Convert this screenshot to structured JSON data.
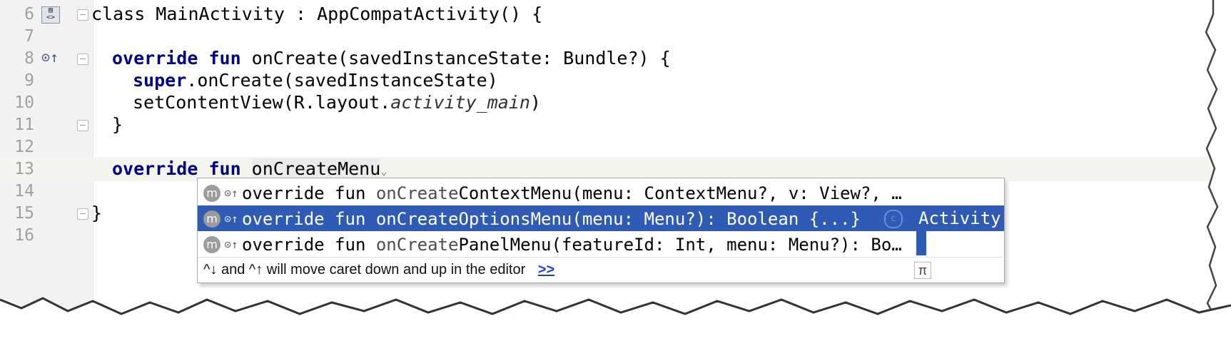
{
  "editor": {
    "lines": [
      {
        "num": "6",
        "code": "class MainActivity : AppCompatActivity() {"
      },
      {
        "num": "7",
        "code": ""
      },
      {
        "num": "8",
        "kw": "override fun ",
        "code": "onCreate(savedInstanceState: Bundle?) {"
      },
      {
        "num": "9",
        "kw": "super",
        "code": ".onCreate(savedInstanceState)"
      },
      {
        "num": "10",
        "code_a": "setContentView(R.layout.",
        "code_it": "activity_main",
        "code_b": ")"
      },
      {
        "num": "11",
        "code": "}"
      },
      {
        "num": "12",
        "code": ""
      },
      {
        "num": "13",
        "kw": "override fun ",
        "code": "onCreateMenu"
      },
      {
        "num": "14",
        "code": ""
      },
      {
        "num": "15",
        "code": "}"
      },
      {
        "num": "16",
        "code": ""
      }
    ]
  },
  "popup": {
    "items": [
      {
        "prefix": "override fun ",
        "fn": "onCreate",
        "rest": "ContextMenu(menu: ContextMenu?, v: View?, …"
      },
      {
        "prefix": "override fun ",
        "fn": "onCreate",
        "rest": "OptionsMenu(menu: Menu?): Boolean {...}",
        "owner": "Activity"
      },
      {
        "prefix": "override fun ",
        "fn": "onCreate",
        "rest": "PanelMenu(featureId: Int, menu: Menu?): Bo…"
      }
    ],
    "method_badge": "m",
    "class_badge": "c",
    "hint_text": "^↓ and ^↑ will move caret down and up in the editor",
    "hint_link": ">>",
    "pi_symbol": "π"
  }
}
